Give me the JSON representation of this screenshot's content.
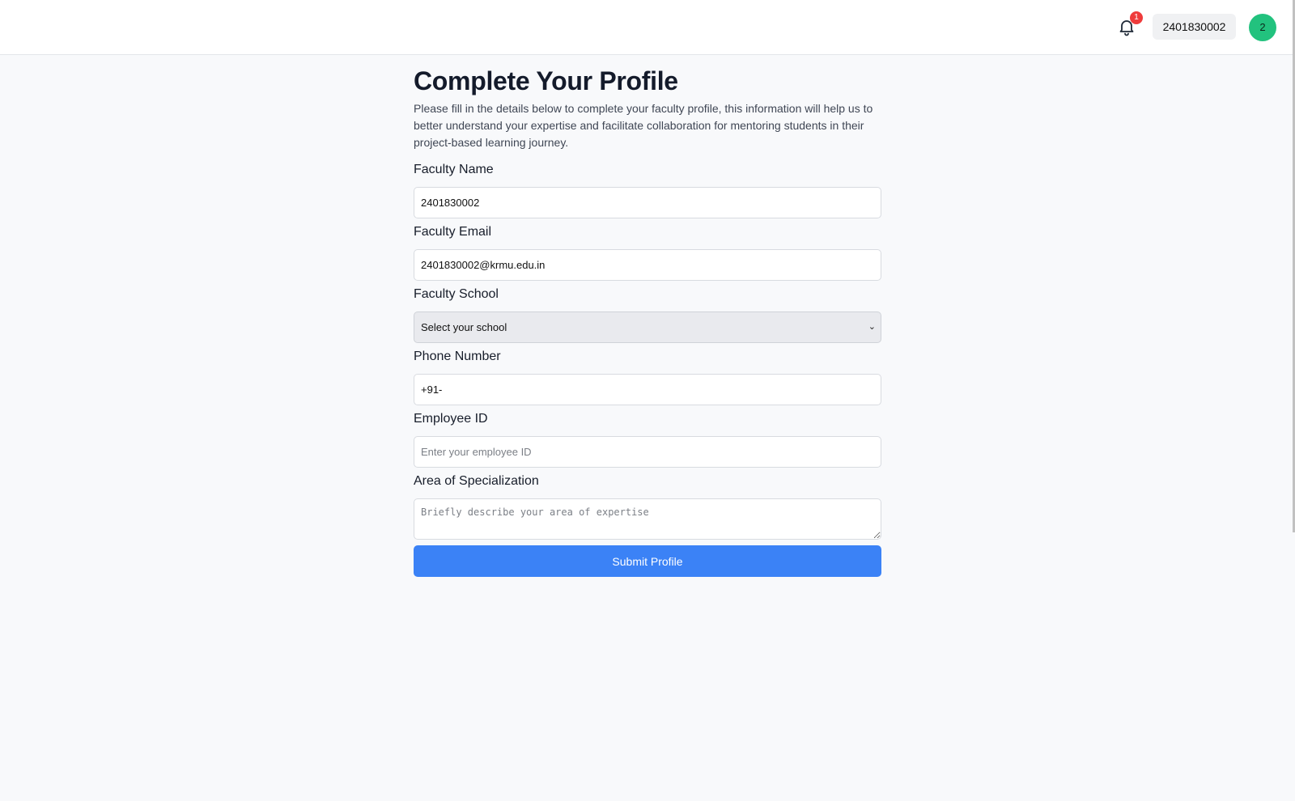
{
  "header": {
    "notification_count": "1",
    "username": "2401830002",
    "avatar_initial": "2"
  },
  "main": {
    "title": "Complete Your Profile",
    "description": "Please fill in the details below to complete your faculty profile, this information will help us to better understand your expertise and facilitate collaboration for mentoring students in their project-based learning journey."
  },
  "form": {
    "faculty_name": {
      "label": "Faculty Name",
      "value": "2401830002"
    },
    "faculty_email": {
      "label": "Faculty Email",
      "value": "2401830002@krmu.edu.in"
    },
    "faculty_school": {
      "label": "Faculty School",
      "selected": "Select your school"
    },
    "phone_number": {
      "label": "Phone Number",
      "value": "+91-"
    },
    "employee_id": {
      "label": "Employee ID",
      "placeholder": "Enter your employee ID"
    },
    "specialization": {
      "label": "Area of Specialization",
      "placeholder": "Briefly describe your area of expertise"
    },
    "submit_label": "Submit Profile"
  },
  "icons": {
    "notifications": "bell-icon",
    "dropdown": "chevron-down-icon"
  },
  "colors": {
    "accent": "#3b82f6",
    "avatar": "#22c27e",
    "badge": "#ef3b3b"
  }
}
